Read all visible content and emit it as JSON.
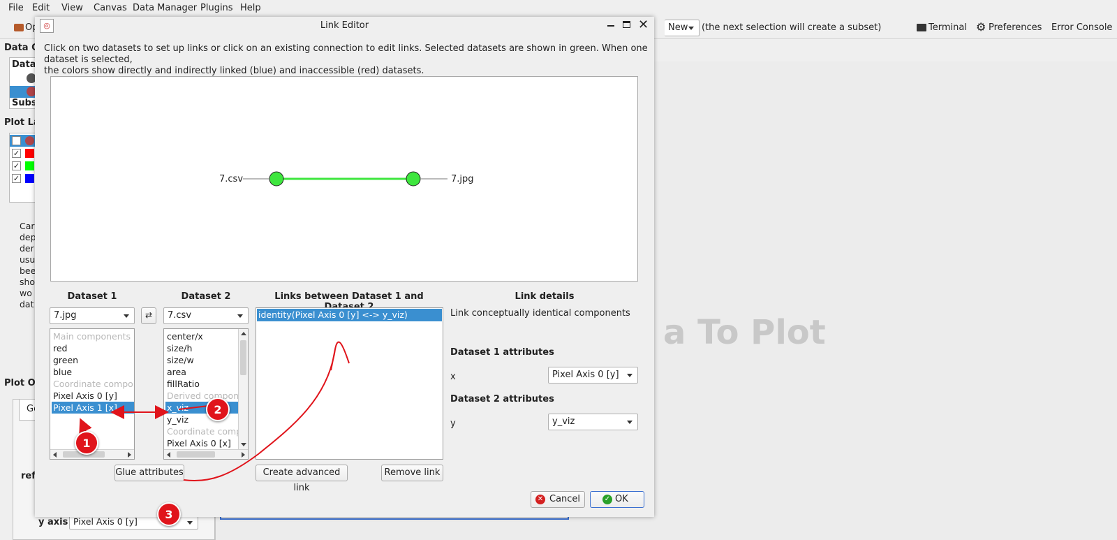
{
  "menubar": {
    "items": [
      "File",
      "Edit",
      "View",
      "Canvas",
      "Data Manager",
      "Plugins",
      "Help"
    ]
  },
  "toolbar": {
    "open_label": "Op",
    "mode_combo": "New",
    "mode_hint": "(the next selection will create a subset)",
    "terminal_label": "Terminal",
    "preferences_label": "Preferences",
    "error_console_label": "Error Console"
  },
  "left_panel": {
    "data_collection_header": "Data Co",
    "data_header": "Data",
    "subsets_header": "Subse",
    "plot_layers_header": "Plot La",
    "help_text_lines": [
      "Car",
      "dep",
      "der",
      "usu",
      "bee",
      "sho",
      "wo",
      "dat"
    ],
    "plot_options_header": "Plot Op",
    "general_tab": "Gen",
    "ref_label": "ref",
    "y_axis_label": "y axis",
    "y_axis_value": "Pixel Axis 0 [y]"
  },
  "canvas": {
    "hint": "a To Plot"
  },
  "dialog": {
    "title": "Link Editor",
    "instructions_line1": "Click on two datasets to set up links or click on an existing connection to edit links. Selected datasets are shown in green. When one dataset is selected,",
    "instructions_line2": "the colors show directly and indirectly linked (blue) and inaccessible (red) datasets.",
    "graph": {
      "left_node": "7.csv",
      "right_node": "7.jpg",
      "node_color": "#3ee63e",
      "link_color": "#3ee63e"
    },
    "dataset1": {
      "header": "Dataset 1",
      "selected": "7.jpg",
      "items": [
        {
          "label": "Main components",
          "muted": true
        },
        {
          "label": "red"
        },
        {
          "label": "green"
        },
        {
          "label": "blue"
        },
        {
          "label": "Coordinate compone",
          "muted": true
        },
        {
          "label": "Pixel Axis 0 [y]"
        },
        {
          "label": "Pixel Axis 1 [x]",
          "selected": true
        }
      ]
    },
    "dataset2": {
      "header": "Dataset 2",
      "selected": "7.csv",
      "items": [
        {
          "label": "center/x"
        },
        {
          "label": "size/h"
        },
        {
          "label": "size/w"
        },
        {
          "label": "area"
        },
        {
          "label": "fillRatio"
        },
        {
          "label": "Derived compone",
          "muted": true
        },
        {
          "label": "x_viz",
          "selected": true
        },
        {
          "label": "y_viz"
        },
        {
          "label": "Coordinate compo",
          "muted": true
        },
        {
          "label": "Pixel Axis 0 [x]"
        }
      ]
    },
    "links": {
      "header": "Links between Dataset 1 and Dataset 2",
      "items": [
        "identity(Pixel Axis 0 [y] <-> y_viz)"
      ]
    },
    "details": {
      "header": "Link details",
      "description": "Link conceptually identical components",
      "ds1_attr_header": "Dataset 1 attributes",
      "ds1_attr_name": "x",
      "ds1_attr_value": "Pixel Axis 0 [y]",
      "ds2_attr_header": "Dataset 2 attributes",
      "ds2_attr_name": "y",
      "ds2_attr_value": "y_viz"
    },
    "glue_button": "Glue attributes",
    "advanced_button": "Create advanced link",
    "remove_button": "Remove link",
    "cancel_button": "Cancel",
    "ok_button": "OK"
  },
  "annotations": {
    "badges": [
      "1",
      "2",
      "3"
    ],
    "color": "#e0141b"
  }
}
